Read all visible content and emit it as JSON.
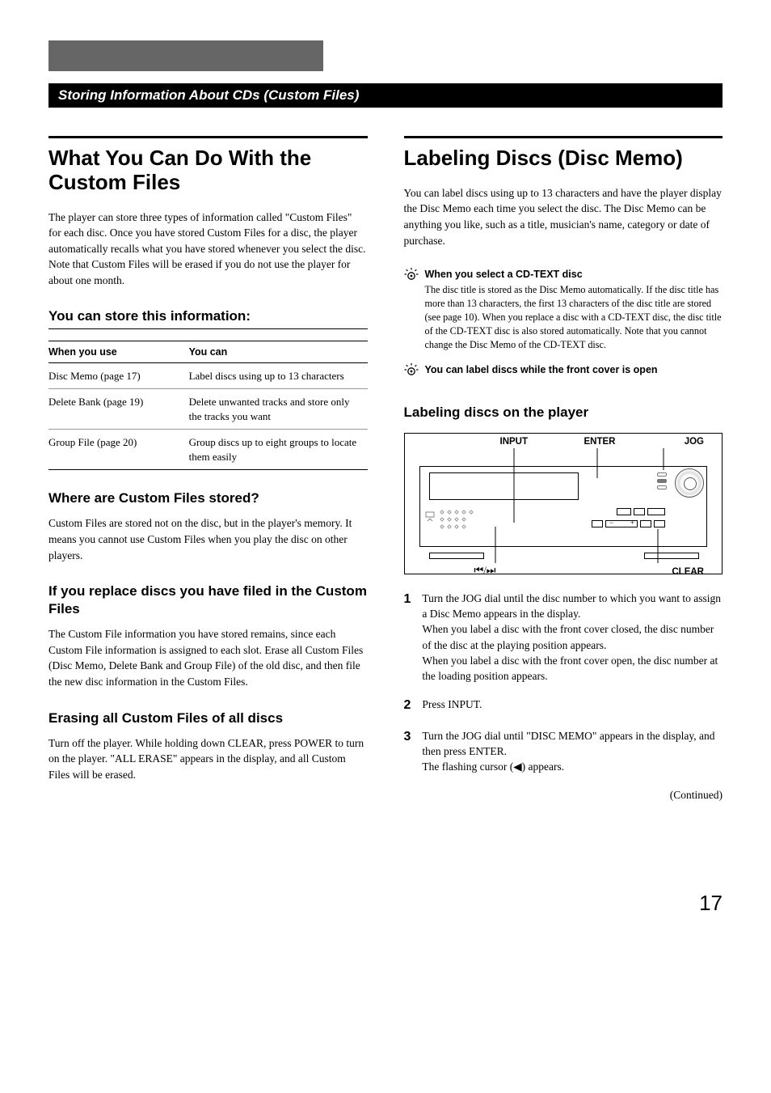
{
  "banner": "Storing Information About CDs (Custom Files)",
  "left": {
    "title": "What You Can Do With the Custom Files",
    "intro": "The player can store three types of information called \"Custom Files\" for each disc. Once you have stored Custom Files for a disc, the player automatically recalls what you have stored whenever you select the disc. Note that Custom Files will be erased if you do not use the player for about one month.",
    "store_heading": "You can store this information:",
    "table": {
      "col1": "When you use",
      "col2": "You can",
      "rows": [
        {
          "c1": "Disc Memo (page 17)",
          "c2": "Label discs using up to 13 characters"
        },
        {
          "c1": "Delete Bank (page 19)",
          "c2": "Delete unwanted tracks and store only the tracks you want"
        },
        {
          "c1": "Group File (page 20)",
          "c2": "Group discs up to eight groups to locate them easily"
        }
      ]
    },
    "h_where": "Where are Custom Files stored?",
    "p_where": "Custom Files are stored not on the disc, but in the player's memory. It means you cannot use Custom Files when you play the disc on other players.",
    "h_replace": "If you replace discs you have filed in the Custom Files",
    "p_replace": "The Custom File information you have stored remains, since each Custom File information is assigned to each slot. Erase all Custom Files (Disc Memo, Delete Bank and Group File) of the old disc, and then file the new disc information in the Custom Files.",
    "h_erase": "Erasing all Custom Files of all discs",
    "p_erase": "Turn off the player. While holding down CLEAR, press POWER to turn on the player. \"ALL ERASE\" appears in the display, and all Custom Files will be erased."
  },
  "right": {
    "title": "Labeling Discs (Disc Memo)",
    "intro": "You can label discs using up to 13 characters and have the player display the Disc Memo each time you select the disc. The Disc Memo can be anything you like, such as a title, musician's name, category or date of purchase.",
    "tip1_head": "When you select a CD-TEXT disc",
    "tip1_body": "The disc title is stored as the Disc Memo automatically. If the disc title has more than 13 characters, the first 13 characters of the disc title are stored (see page 10). When you replace a disc with a CD-TEXT disc, the disc title of the CD-TEXT disc is also stored automatically. Note that you cannot change the Disc Memo of the CD-TEXT disc.",
    "tip2_head": "You can label discs while the front cover is open",
    "h_player": "Labeling discs on the player",
    "labels": {
      "input": "INPUT",
      "enter": "ENTER",
      "jog": "JOG",
      "prev_next": "≠/±",
      "clear": "CLEAR"
    },
    "steps": [
      "Turn the JOG dial until the disc number to which you want to assign a Disc Memo appears in the display.\nWhen you label a disc with the front cover closed, the disc number of the disc at the playing position appears.\nWhen you label a disc with the front cover open, the disc number at the loading position appears.",
      "Press INPUT.",
      "Turn the JOG dial until \"DISC MEMO\" appears in the display, and then press ENTER.\nThe flashing cursor (◀) appears."
    ],
    "continued": "(Continued)"
  },
  "page_number": "17"
}
